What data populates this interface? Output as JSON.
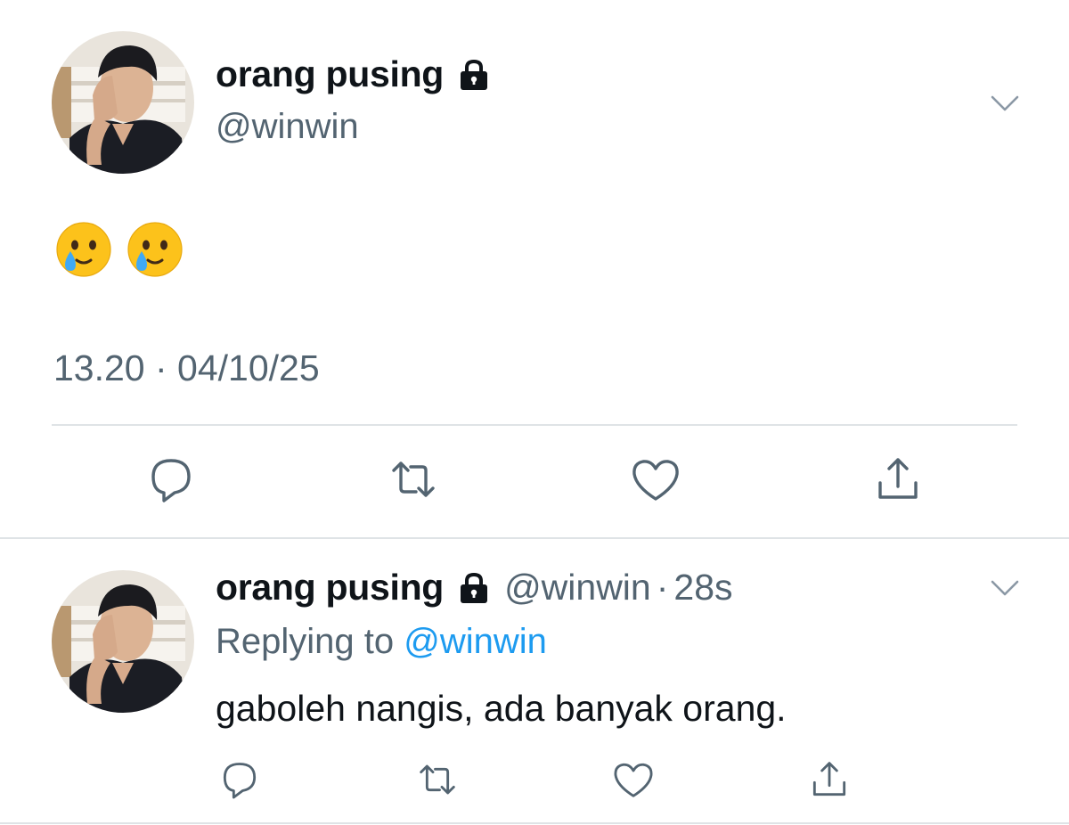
{
  "main_tweet": {
    "display_name": "orang pusing",
    "handle": "@winwin",
    "body_emojis": [
      "smiling-face-with-tear",
      "smiling-face-with-tear"
    ],
    "timestamp": "13.20 · 04/10/25",
    "actions": [
      "reply-icon",
      "retweet-icon",
      "like-icon",
      "share-icon"
    ]
  },
  "reply_tweet": {
    "display_name": "orang pusing",
    "handle": "@winwin",
    "separator": "·",
    "time": "28s",
    "replying_prefix": "Replying to ",
    "replying_to": "@winwin",
    "text": "gaboleh nangis, ada banyak orang.",
    "actions": [
      "reply-icon",
      "retweet-icon",
      "like-icon",
      "share-icon"
    ]
  },
  "colors": {
    "text": "#0f1419",
    "secondary": "#536471",
    "link": "#1d9bf0",
    "divider": "#dfe3e6"
  }
}
